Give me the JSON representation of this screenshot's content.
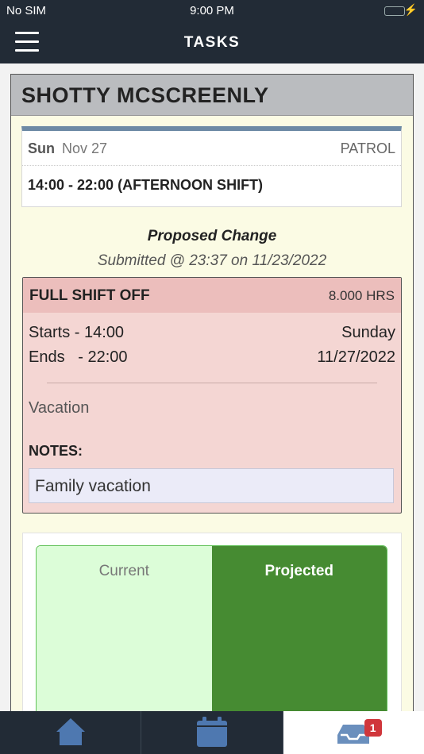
{
  "status_bar": {
    "carrier": "No SIM",
    "time": "9:00 PM",
    "battery_level": 1.0
  },
  "nav": {
    "title": "TASKS",
    "menu_icon": "hamburger-menu-icon"
  },
  "employee": {
    "name": "SHOTTY MCSCREENLY"
  },
  "shift": {
    "day": "Sun",
    "date": "Nov 27",
    "department": "PATROL",
    "time": "14:00 - 22:00 (AFTERNOON SHIFT)"
  },
  "proposed": {
    "title": "Proposed Change",
    "submitted": "Submitted @ 23:37 on 11/23/2022"
  },
  "change": {
    "type": "FULL SHIFT OFF",
    "hours": "8.000 HRS",
    "starts": "Starts - 14:00",
    "starts_day": "Sunday",
    "ends": "Ends   - 22:00",
    "ends_date": "11/27/2022",
    "reason": "Vacation",
    "notes_label": "NOTES:",
    "notes": "Family vacation"
  },
  "balance": {
    "tabs": [
      {
        "label": "Current",
        "selected": false
      },
      {
        "label": "Projected",
        "selected": true
      }
    ]
  },
  "tab_bar": {
    "tabs": [
      {
        "icon": "home-icon",
        "active": false
      },
      {
        "icon": "calendar-icon",
        "active": false
      },
      {
        "icon": "inbox-icon",
        "active": true,
        "badge": "1"
      }
    ]
  },
  "colors": {
    "nav_bg": "#222b36",
    "card_bg": "#fbfbe4",
    "change_bg": "#f4d6d3",
    "change_header_bg": "#ecbebc",
    "accent_blue": "#4e78b0",
    "projected_green": "#468b32",
    "current_green": "#dcfdd8",
    "badge_red": "#d0363b"
  }
}
